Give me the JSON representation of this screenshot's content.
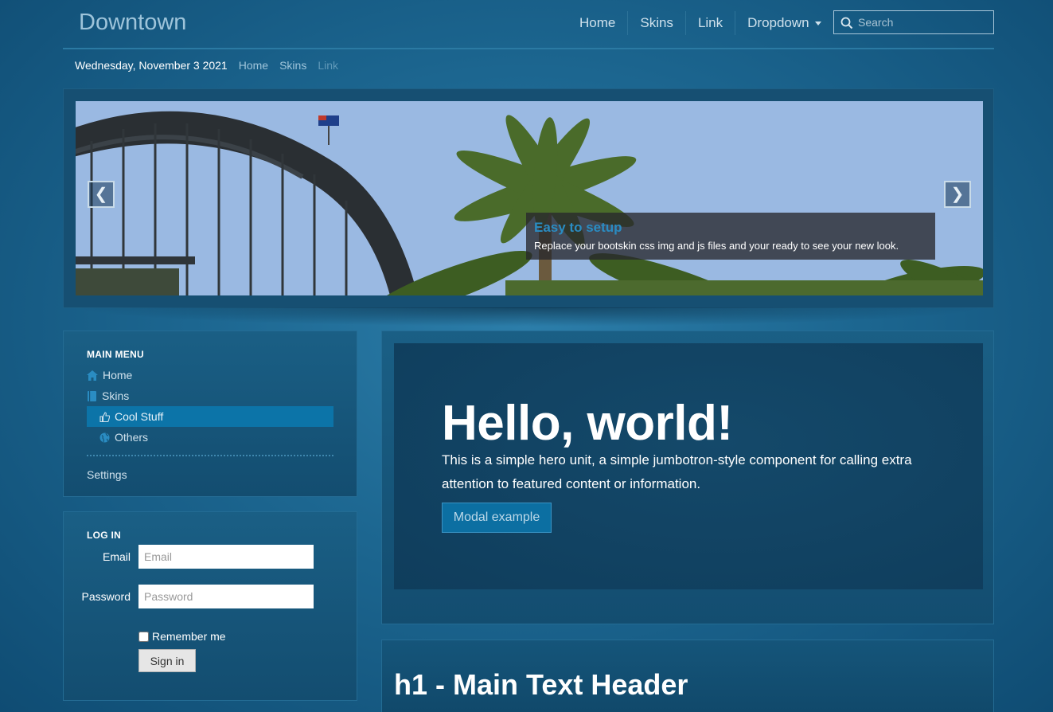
{
  "brand": "Downtown",
  "navbar": {
    "items": [
      {
        "label": "Home"
      },
      {
        "label": "Skins"
      },
      {
        "label": "Link"
      },
      {
        "label": "Dropdown"
      }
    ],
    "search_placeholder": "Search"
  },
  "breadcrumb": {
    "date": "Wednesday, November 3 2021",
    "links": [
      "Home",
      "Skins",
      "Link"
    ]
  },
  "carousel": {
    "prev_glyph": "❮",
    "next_glyph": "❯",
    "caption_title": "Easy to setup",
    "caption_text": "Replace your bootskin css img and js files and your ready to see your new look."
  },
  "main_menu": {
    "title": "MAIN MENU",
    "items": [
      {
        "label": "Home",
        "icon": "home-icon"
      },
      {
        "label": "Skins",
        "icon": "book-icon"
      },
      {
        "label": "Cool Stuff",
        "icon": "thumbs-up-icon",
        "active": true
      },
      {
        "label": "Others",
        "icon": "globe-icon"
      }
    ],
    "settings": "Settings"
  },
  "login": {
    "title": "LOG IN",
    "email_label": "Email",
    "email_placeholder": "Email",
    "password_label": "Password",
    "password_placeholder": "Password",
    "remember_label": "Remember me",
    "signin_label": "Sign in"
  },
  "hero": {
    "title": "Hello, world!",
    "text": "This is a simple hero unit, a simple jumbotron-style component for calling extra attention to featured content or information.",
    "button_label": "Modal example"
  },
  "h1_header": "h1 - Main Text Header",
  "colors": {
    "accent": "#0c74a8",
    "caption_title": "#2a8cc2",
    "background": "#1c6690"
  }
}
